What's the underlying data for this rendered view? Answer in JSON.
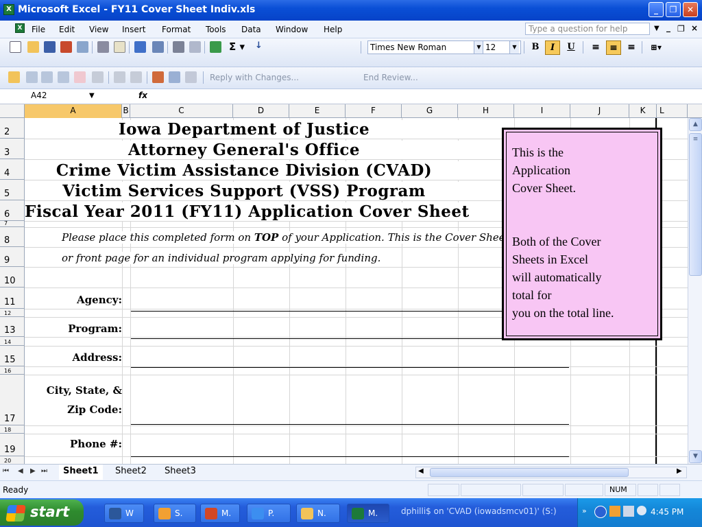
{
  "window": {
    "title": "Microsoft Excel - FY11 Cover Sheet Indiv.xls",
    "app_icon": "excel-icon"
  },
  "menu": {
    "items": [
      "File",
      "Edit",
      "View",
      "Insert",
      "Format",
      "Tools",
      "Data",
      "Window",
      "Help"
    ],
    "help_placeholder": "Type a question for help"
  },
  "format_toolbar": {
    "font": "Times New Roman",
    "size": "12",
    "bold": "B",
    "italic": "I",
    "underline": "U"
  },
  "review_toolbar": {
    "reply_label": "Reply with Changes...",
    "end_review_label": "End Review..."
  },
  "formula_bar": {
    "name_box": "A42",
    "fx": "fx",
    "value": ""
  },
  "grid": {
    "columns": [
      "A",
      "B",
      "C",
      "D",
      "E",
      "F",
      "G",
      "H",
      "I",
      "J",
      "K",
      "L"
    ],
    "selected_column": "A",
    "rows": [
      "2",
      "3",
      "4",
      "5",
      "6",
      "7",
      "8",
      "9",
      "10",
      "11",
      "12",
      "13",
      "14",
      "15",
      "16",
      "17",
      "18",
      "19",
      "20"
    ]
  },
  "sheet": {
    "header_lines": [
      "Iowa Department of Justice",
      "Attorney General's Office",
      "Crime Victim Assistance Division (CVAD)",
      "Victim Services Support (VSS) Program",
      "Fiscal Year 2011 (FY11) Application Cover Sheet"
    ],
    "instr_part1": "Please place this completed form on ",
    "instr_bold": "TOP",
    "instr_part2": " of your Application.  This is the Cover Sheet",
    "instr_line2": "or front page for an individual program applying for funding.",
    "fields": {
      "agency": "Agency:",
      "program": "Program:",
      "address": "Address:",
      "city1": "City, State, &",
      "city2": "Zip Code:",
      "phone": "Phone #:"
    }
  },
  "comment": {
    "line1": "This is the",
    "line2": "Application",
    "line3": "Cover Sheet.",
    "line4": "Both of the Cover",
    "line5": "Sheets in Excel",
    "line6": "will automatically",
    "line7": "total for",
    "line8": "you on the total line.",
    "bg_color": "#f8c6f4"
  },
  "tabs": [
    "Sheet1",
    "Sheet2",
    "Sheet3"
  ],
  "status": {
    "left": "Ready",
    "num": "NUM"
  },
  "taskbar": {
    "start": "start",
    "buttons": [
      "W",
      "S.",
      "M.",
      "P.",
      "N.",
      "M."
    ],
    "network": "dphilli$ on 'CVAD (iowadsmcv01)' (S:)",
    "clock": "4:45 PM"
  }
}
